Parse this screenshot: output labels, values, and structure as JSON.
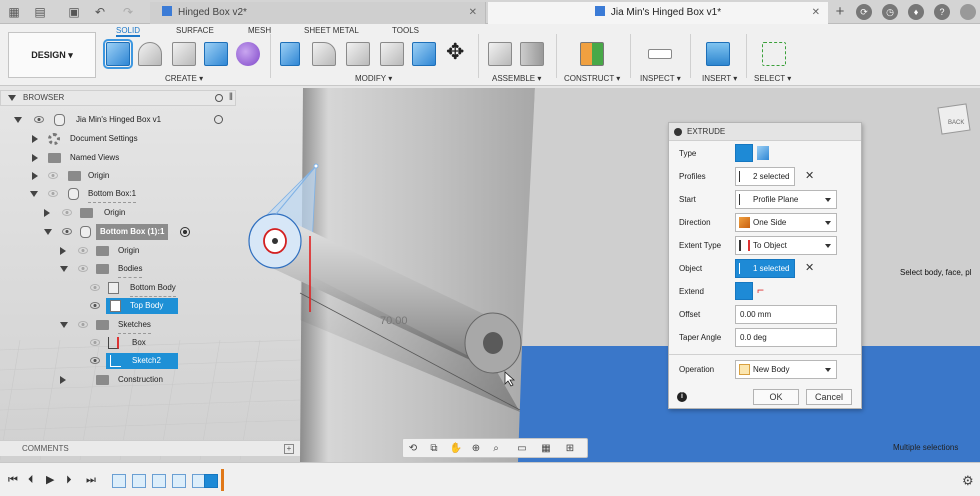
{
  "tabs": [
    {
      "label": "Hinged Box v2*",
      "active": false
    },
    {
      "label": "Jia Min's Hinged Box v1*",
      "active": true
    }
  ],
  "ribbon": {
    "design_label": "DESIGN ▾",
    "tabs": [
      "SOLID",
      "SURFACE",
      "MESH",
      "SHEET METAL",
      "TOOLS"
    ],
    "groups": [
      "CREATE ▾",
      "MODIFY ▾",
      "ASSEMBLE ▾",
      "CONSTRUCT ▾",
      "INSPECT ▾",
      "INSERT ▾",
      "SELECT ▾"
    ]
  },
  "browser": {
    "title": "BROWSER",
    "items": [
      {
        "label": "Jia Min's Hinged Box v1"
      },
      {
        "label": "Document Settings"
      },
      {
        "label": "Named Views"
      },
      {
        "label": "Origin"
      },
      {
        "label": "Bottom Box:1"
      },
      {
        "label": "Origin"
      },
      {
        "label": "Bottom Box (1):1"
      },
      {
        "label": "Origin"
      },
      {
        "label": "Bodies"
      },
      {
        "label": "Bottom Body"
      },
      {
        "label": "Top Body"
      },
      {
        "label": "Sketches"
      },
      {
        "label": "Box"
      },
      {
        "label": "Sketch2"
      },
      {
        "label": "Construction"
      }
    ]
  },
  "canvas": {
    "dimension_label": "70.00",
    "viewcube_label": "BACK",
    "tooltip": "Select body, face, pl",
    "status": "Multiple selections"
  },
  "comments": {
    "label": "COMMENTS"
  },
  "extrude": {
    "title": "EXTRUDE",
    "rows": [
      {
        "label": "Type"
      },
      {
        "label": "Profiles",
        "value": "2 selected"
      },
      {
        "label": "Start",
        "value": "Profile Plane"
      },
      {
        "label": "Direction",
        "value": "One Side"
      },
      {
        "label": "Extent Type",
        "value": "To Object"
      },
      {
        "label": "Object",
        "value": "1 selected"
      },
      {
        "label": "Extend"
      },
      {
        "label": "Offset",
        "value": "0.00 mm"
      },
      {
        "label": "Taper Angle",
        "value": "0.0 deg"
      },
      {
        "label": "Operation",
        "value": "New Body"
      }
    ],
    "ok": "OK",
    "cancel": "Cancel"
  },
  "colors": {
    "accent": "#1e8ad6",
    "selected_face": "#3a77c9",
    "red_edge": "#e02020"
  }
}
